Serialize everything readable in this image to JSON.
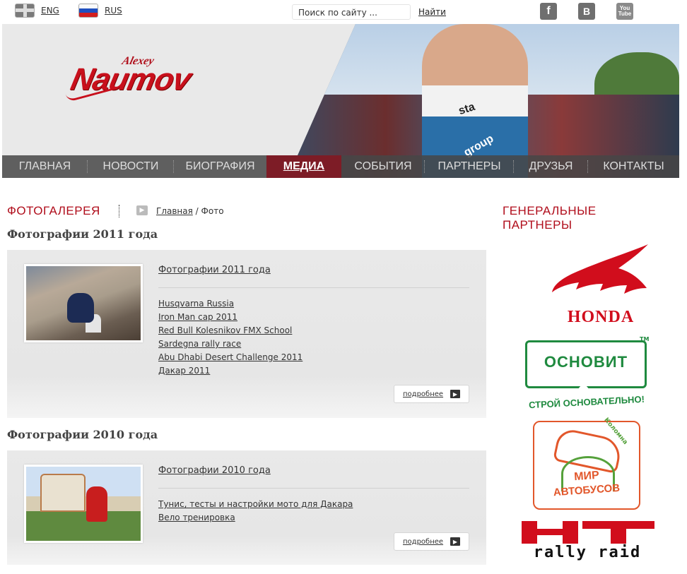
{
  "topbar": {
    "languages": [
      {
        "code": "ENG"
      },
      {
        "code": "RUS"
      }
    ],
    "search": {
      "placeholder": "Поиск по сайту ...",
      "button_label": "Найти"
    },
    "social": [
      {
        "name": "facebook",
        "glyph": "f"
      },
      {
        "name": "vkontakte",
        "glyph": "B"
      },
      {
        "name": "youtube",
        "glyph_top": "You",
        "glyph_bottom": "Tube"
      }
    ]
  },
  "logo": {
    "first_name": "Alexey",
    "last_name": "Naumov"
  },
  "photo_banner": {
    "jersey_text_1": "sta",
    "jersey_text_2": "group"
  },
  "nav": {
    "items": [
      {
        "label": "Главная",
        "active": false
      },
      {
        "label": "Новости",
        "active": false
      },
      {
        "label": "Биография",
        "active": false
      },
      {
        "label": "Медиа",
        "active": true
      },
      {
        "label": "События",
        "active": false
      },
      {
        "label": "Партнеры",
        "active": false
      },
      {
        "label": "Друзья",
        "active": false
      },
      {
        "label": "Контакты",
        "active": false
      }
    ]
  },
  "page": {
    "title": "ФОТОГАЛЕРЕЯ",
    "breadcrumb": {
      "home": "Главная",
      "separator": "/",
      "current": "Фото"
    }
  },
  "sections": [
    {
      "heading": "Фотографии 2011 года",
      "album_link": "Фотографии 2011 года",
      "links": [
        "Husqvarna Russia",
        "Iron Man cap 2011",
        "Red Bull Kolesnikov FMX School",
        "Sardegna rally race",
        "Abu Dhabi Desert Challenge 2011",
        "Дакар 2011"
      ],
      "more_label": "подробнее"
    },
    {
      "heading": "Фотографии 2010 года",
      "album_link": "Фотографии 2010 года",
      "links": [
        "Тунис, тесты и настройки мото для Дакара",
        "Вело тренировка"
      ],
      "more_label": "подробнее"
    }
  ],
  "sidebar": {
    "title": "ГЕНЕРАЛЬНЫЕ ПАРТНЕРЫ",
    "partners": {
      "honda": {
        "name": "HONDA"
      },
      "osnovit": {
        "name": "ОСНОВИТ",
        "tm": "TM",
        "slogan": "СТРОЙ ОСНОВАТЕЛЬНО!"
      },
      "mir": {
        "line1": "МИР",
        "line2": "АВТОБУСОВ",
        "city": "Коломна"
      },
      "ht": {
        "name": "rally raid"
      }
    }
  },
  "colors": {
    "brand_red": "#b00d1b",
    "nav_bg": "#464646",
    "nav_active": "#7d1c26",
    "osnovit_green": "#1f8a3f",
    "mir_orange": "#e2572b"
  }
}
